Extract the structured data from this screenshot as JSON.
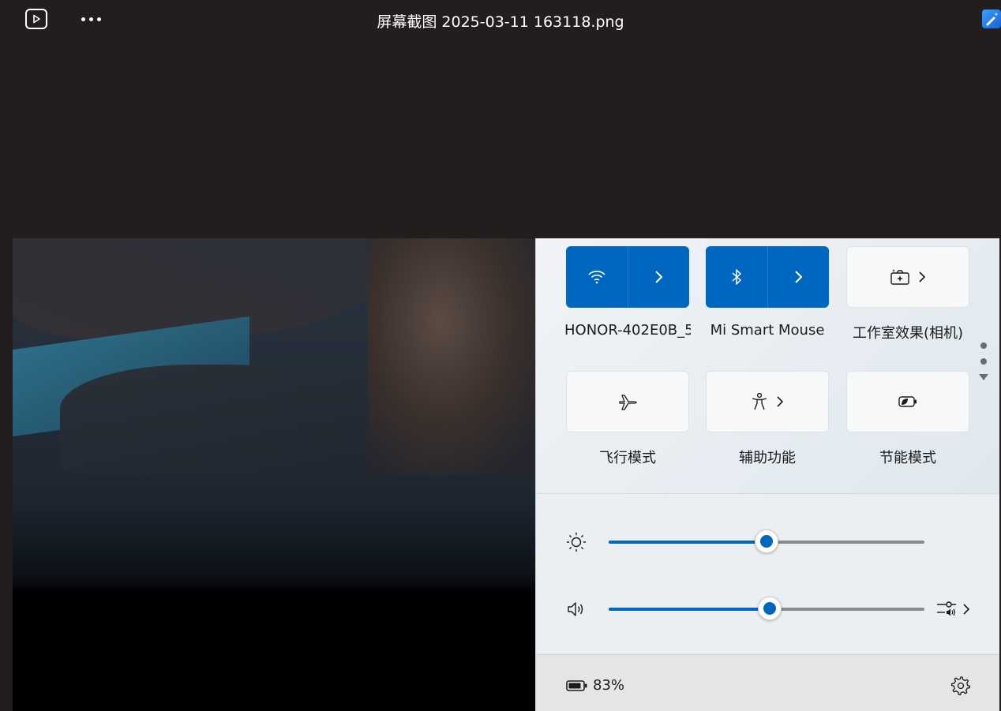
{
  "titlebar": {
    "title": "屏幕截图 2025-03-11 163118.png",
    "play_icon": "slideshow-play-icon",
    "more_icon": "more-dots-icon",
    "app_icon": "photos-edit-icon"
  },
  "quick_settings": {
    "tiles": [
      {
        "id": "wifi",
        "label": "HONOR-402E0B_5",
        "state": "on",
        "icon": "wifi-icon",
        "has_chevron": true
      },
      {
        "id": "bluetooth",
        "label": "Mi Smart Mouse",
        "state": "on",
        "icon": "bluetooth-icon",
        "has_chevron": true
      },
      {
        "id": "studio-effects",
        "label": "工作室效果(相机)",
        "state": "off",
        "icon": "studio-effects-icon",
        "has_chevron": true
      },
      {
        "id": "airplane",
        "label": "飞行模式",
        "state": "off",
        "icon": "airplane-icon",
        "has_chevron": false
      },
      {
        "id": "accessibility",
        "label": "辅助功能",
        "state": "off",
        "icon": "accessibility-icon",
        "has_chevron": true
      },
      {
        "id": "energy-saver",
        "label": "节能模式",
        "state": "off",
        "icon": "energy-saver-icon",
        "has_chevron": false
      }
    ],
    "brightness": {
      "icon": "brightness-icon",
      "level": 0.5
    },
    "volume": {
      "icon": "speaker-icon",
      "level": 0.51,
      "output_icon": "audio-output-icon"
    },
    "battery": {
      "percent": "83%",
      "icon": "battery-icon"
    },
    "settings_icon": "gear-icon",
    "accent_color": "#0067c0"
  }
}
